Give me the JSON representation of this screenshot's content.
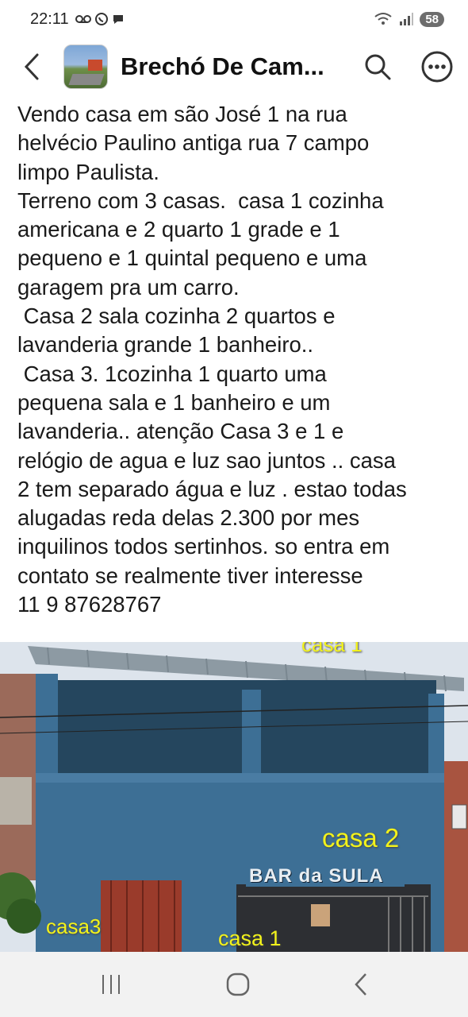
{
  "status_bar": {
    "time": "22:11",
    "notification_icons": [
      "voicemail-icon",
      "whatsapp-icon",
      "chat-icon"
    ],
    "battery": "58"
  },
  "app_bar": {
    "title": "Brechó De Cam..."
  },
  "post": {
    "text": "Vendo casa em são José 1 na rua\nhelvécio Paulino antiga rua 7 campo\nlimpo Paulista.\nTerreno com 3 casas.  casa 1 cozinha\namericana e 2 quarto 1 grade e 1\npequeno e 1 quintal pequeno e uma\ngaragem pra um carro.\n Casa 2 sala cozinha 2 quartos e\nlavanderia grande 1 banheiro..\n Casa 3. 1cozinha 1 quarto uma\npequena sala e 1 banheiro e um\nlavanderia.. atenção Casa 3 e 1 e\nrelógio de agua e luz sao juntos .. casa\n2 tem separado água e luz . estao todas\nalugadas reda delas 2.300 por mes\ninquilinos todos sertinhos. so entra em\ncontato se realmente tiver interesse\n11 9 87628767"
  },
  "photo": {
    "labels": {
      "casa_top": "casa 1",
      "casa2": "casa 2",
      "casa3": "casa3",
      "casa1": "casa 1"
    },
    "sign": "BAR da SULA",
    "colors": {
      "wall": "#3d6f95",
      "roof": "#8d9aa3",
      "door": "#9a3b2b",
      "label": "#f2f21b"
    }
  },
  "nav_bar": {
    "items": [
      "recent-apps-icon",
      "home-icon",
      "back-icon"
    ]
  }
}
